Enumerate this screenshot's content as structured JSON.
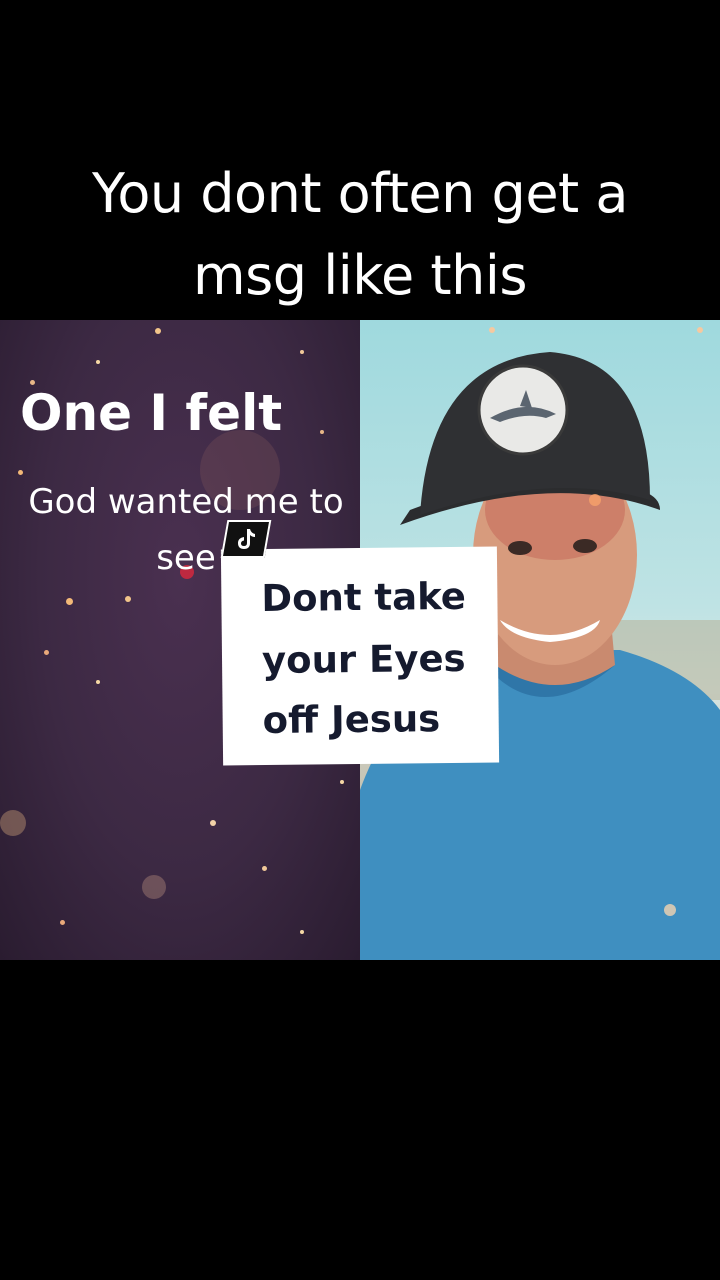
{
  "caption": {
    "line1": "You dont often get a",
    "line2": "msg like this"
  },
  "left_panel": {
    "title": "One I felt",
    "subtitle_line1": "God wanted me to",
    "subtitle_line2": "see"
  },
  "sticker": {
    "line1": "Dont take",
    "line2": "your Eyes",
    "line3": "off Jesus"
  },
  "icons": {
    "badge": "tiktok-logo-icon",
    "cap_patch": "shark-patch-icon"
  },
  "colors": {
    "left_bg": "#3c2943",
    "sticker_text": "#151a2e",
    "shirt": "#3f8fc0",
    "sky": "#a9dde0"
  }
}
